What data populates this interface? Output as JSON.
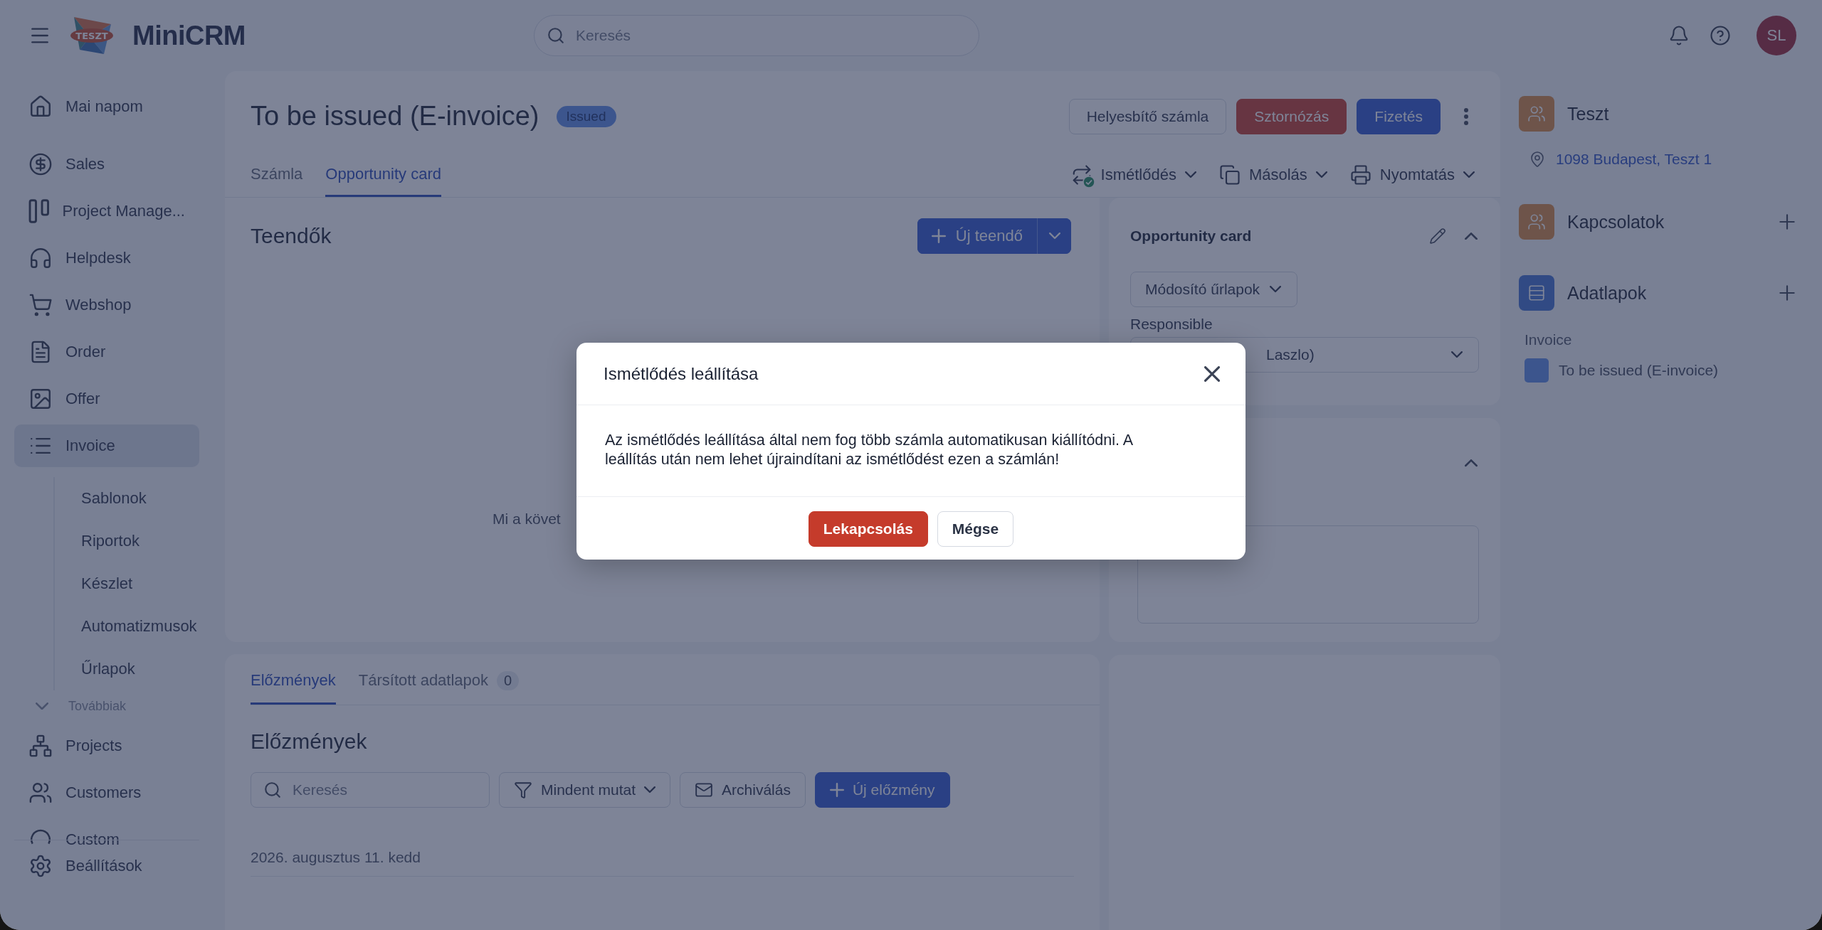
{
  "topbar": {
    "brand": "MiniCRM",
    "logo_badge": "TESZT",
    "search": {
      "placeholder": "Keresés"
    },
    "avatar": "SL"
  },
  "sidebar": {
    "items": [
      {
        "label": "Mai napom",
        "selected": false
      },
      {
        "label": "Sales",
        "selected": false
      },
      {
        "label": "Project Manage...",
        "selected": false
      },
      {
        "label": "Helpdesk",
        "selected": false
      },
      {
        "label": "Webshop",
        "selected": false
      },
      {
        "label": "Order",
        "selected": false
      },
      {
        "label": "Offer",
        "selected": false
      },
      {
        "label": "Invoice",
        "selected": true,
        "children": [
          {
            "label": "Sablonok"
          },
          {
            "label": "Riportok"
          },
          {
            "label": "Készlet"
          },
          {
            "label": "Automatizmusok"
          },
          {
            "label": "Űrlapok"
          }
        ]
      }
    ],
    "more": {
      "label": "Továbbiak",
      "expanded": true
    },
    "more_items": [
      {
        "label": "Projects",
        "selected": false
      },
      {
        "label": "Customers",
        "selected": false
      },
      {
        "label": "Custom",
        "selected": false
      }
    ],
    "settings": "Beállítások"
  },
  "header": {
    "title": "To be issued (E-invoice)",
    "status": "Issued",
    "buttons": [
      {
        "label": "Helyesbítő számla",
        "kind": "outline"
      },
      {
        "label": "Sztornózás",
        "kind": "danger"
      },
      {
        "label": "Fizetés",
        "kind": "primary"
      }
    ],
    "tabs": [
      {
        "label": "Számla",
        "selected": false
      },
      {
        "label": "Opportunity card",
        "selected": true
      }
    ],
    "actions": [
      {
        "label": "Ismétlődés",
        "checked": true
      },
      {
        "label": "Másolás",
        "checked": false
      },
      {
        "label": "Nyomtatás",
        "checked": false
      }
    ]
  },
  "tasks": {
    "title": "Teendők",
    "new_button": "Új teendő",
    "empty_text": "Mi a követ"
  },
  "opportunity": {
    "title": "Opportunity card",
    "forms_button": "Módosító űrlapok",
    "responsible_label": "Responsible",
    "responsible_value": "Laszlo)"
  },
  "history": {
    "tabs": [
      {
        "label": "Előzmények",
        "selected": true
      },
      {
        "label": "Társított adatlapok",
        "count": "0",
        "selected": false
      }
    ],
    "title": "Előzmények",
    "search": {
      "placeholder": "Keresés"
    },
    "filter": "Mindent mutat",
    "archive": "Archiválás",
    "new_button": "Új előzmény",
    "date": "2026. augusztus 11. kedd"
  },
  "right": {
    "contact": {
      "name": "Teszt",
      "address": "1098 Budapest, Teszt 1"
    },
    "sections": [
      {
        "title": "Kapcsolatok",
        "kind": "people"
      },
      {
        "title": "Adatlapok",
        "kind": "sheets"
      }
    ],
    "group": {
      "label": "Invoice",
      "items": [
        {
          "label": "To be issued (E-invoice)"
        }
      ]
    }
  },
  "modal": {
    "title": "Ismétlődés leállítása",
    "body": "Az ismétlődés leállítása által nem fog több számla automatikusan kiállítódni. A leállítás után nem lehet újraindítani az ismétlődést ezen a számlán!",
    "confirm": "Lekapcsolás",
    "cancel": "Mégse"
  }
}
